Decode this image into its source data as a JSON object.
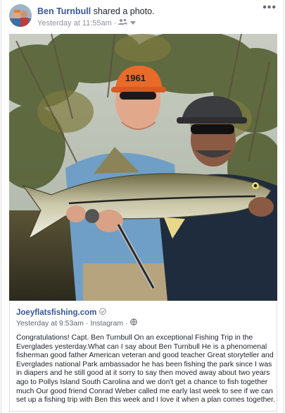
{
  "post": {
    "author": "Ben Turnbull",
    "action": "shared a photo.",
    "timestamp": "Yesterday at 11:55am",
    "audience_icon": "friends-icon",
    "more_label": "•••"
  },
  "shared_post": {
    "source": "Joeyflatsfishing.com",
    "verified_icon": "verified-check-icon",
    "timestamp": "Yesterday at 9:53am",
    "via": "Instagram",
    "privacy_icon": "globe-icon",
    "caption": "Congratulations! Capt. Ben Turnbull On an exceptional Fishing Trip in the Everglades yesterday.What can I say about Ben Turnbull He is a phenomenal fisherman good father American veteran and good teacher Great storyteller and Everglades national Park ambassador he has been fishing the park since I was in diapers and he still good at it sorry to say then moved away about two years ago to Pollys Island South Carolina and we don't get a chance to fish together much Our good friend Conrad Weber called me early last week to see if we can set up a fishing trip with Ben this week and I love it when a plan comes together.",
    "hat_text": "1961"
  },
  "colors": {
    "link": "#385898",
    "meta": "#90949c",
    "text": "#1d2129",
    "border": "#dddfe2"
  }
}
